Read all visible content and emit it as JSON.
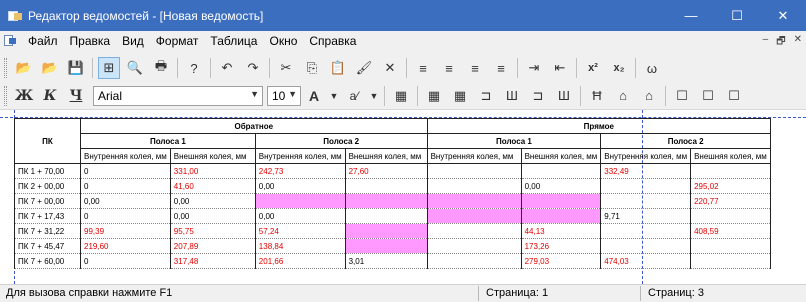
{
  "window": {
    "title": "Редактор ведомостей - [Новая ведомость]",
    "minimize": "—",
    "maximize": "☐",
    "close": "✕",
    "title_color": "#3c6ebf"
  },
  "menu": {
    "items": [
      "Файл",
      "Правка",
      "Вид",
      "Формат",
      "Таблица",
      "Окно",
      "Справка"
    ],
    "mdi_minimize": "–",
    "mdi_restore": "🗗",
    "mdi_close": "✕"
  },
  "toolbar1": {
    "open": "📂",
    "open_special": "📂",
    "save": "💾",
    "grid": "⊞",
    "preview": "🔍",
    "print": "🖶",
    "help": "?",
    "undo": "↶",
    "redo": "↷",
    "cut": "✂",
    "copy": "⎘",
    "paste": "📋",
    "format_painter": "🖌",
    "delete": "✕",
    "align_left": "≡",
    "align_center": "≡",
    "align_right": "≡",
    "justify": "≡",
    "indent": "⇥",
    "outdent": "⇤",
    "superscript": "x²",
    "subscript": "x₂",
    "omega": "ω"
  },
  "toolbar2": {
    "bold": "Ж",
    "italic": "К",
    "underline": "Ч",
    "font_name": "Arial",
    "font_size": "10",
    "text_color": "A",
    "highlight": "a⁄",
    "table": "▦",
    "tool_a": "▦",
    "tool_b": "▦",
    "tool_c": "⊐",
    "tool_d": "Ш",
    "tool_e": "⊐",
    "tool_f": "Ш",
    "tool_g": "Ħ",
    "tool_h": "⌂",
    "tool_i": "⌂",
    "tool_j": "☐",
    "tool_k": "☐",
    "tool_l": "☐"
  },
  "sheet": {
    "col_pk": "ПК",
    "group_reverse": "Обратное",
    "group_direct": "Прямое",
    "lane1": "Полоса 1",
    "lane2": "Полоса 2",
    "inner": "Внутренняя колея, мм",
    "outer": "Внешняя колея, мм",
    "rows": [
      {
        "pk": "ПК 1 + 70,00",
        "c1": "0",
        "c2": "331,00",
        "c3": "242,73",
        "c4": "27,60",
        "c5": "",
        "c6": "",
        "c7": "332,49",
        "c8": ""
      },
      {
        "pk": "ПК 2 + 00,00",
        "c1": "0",
        "c2": "41,60",
        "c3": "0,00",
        "c4": "",
        "c5": "",
        "c6": "0,00",
        "c7": "",
        "c8": "295,02"
      },
      {
        "pk": "ПК 7 + 00,00",
        "c1": "0,00",
        "c2": "0,00",
        "c3": "",
        "c4": "",
        "c5": "",
        "c6": "",
        "c7": "",
        "c8": "220,77"
      },
      {
        "pk": "ПК 7 + 17,43",
        "c1": "0",
        "c2": "0,00",
        "c3": "0,00",
        "c4": "",
        "c5": "",
        "c6": "",
        "c7": "9,71",
        "c8": ""
      },
      {
        "pk": "ПК 7 + 31,22",
        "c1": "99,39",
        "c2": "95,75",
        "c3": "57,24",
        "c4": "",
        "c5": "",
        "c6": "44,13",
        "c7": "",
        "c8": "408,59"
      },
      {
        "pk": "ПК 7 + 45,47",
        "c1": "219,60",
        "c2": "207,89",
        "c3": "138,84",
        "c4": "",
        "c5": "",
        "c6": "173,26",
        "c7": "",
        "c8": ""
      },
      {
        "pk": "ПК 7 + 60,00",
        "c1": "0",
        "c2": "317,48",
        "c3": "201,66",
        "c4": "3,01",
        "c5": "",
        "c6": "279,03",
        "c7": "474,03",
        "c8": ""
      }
    ],
    "highlight_color": "#ff99ff",
    "value_color": "#e00000"
  },
  "status": {
    "hint": "Для вызова справки нажмите F1",
    "page_label": "Страница: 1",
    "pages_label": "Страниц: 3"
  }
}
